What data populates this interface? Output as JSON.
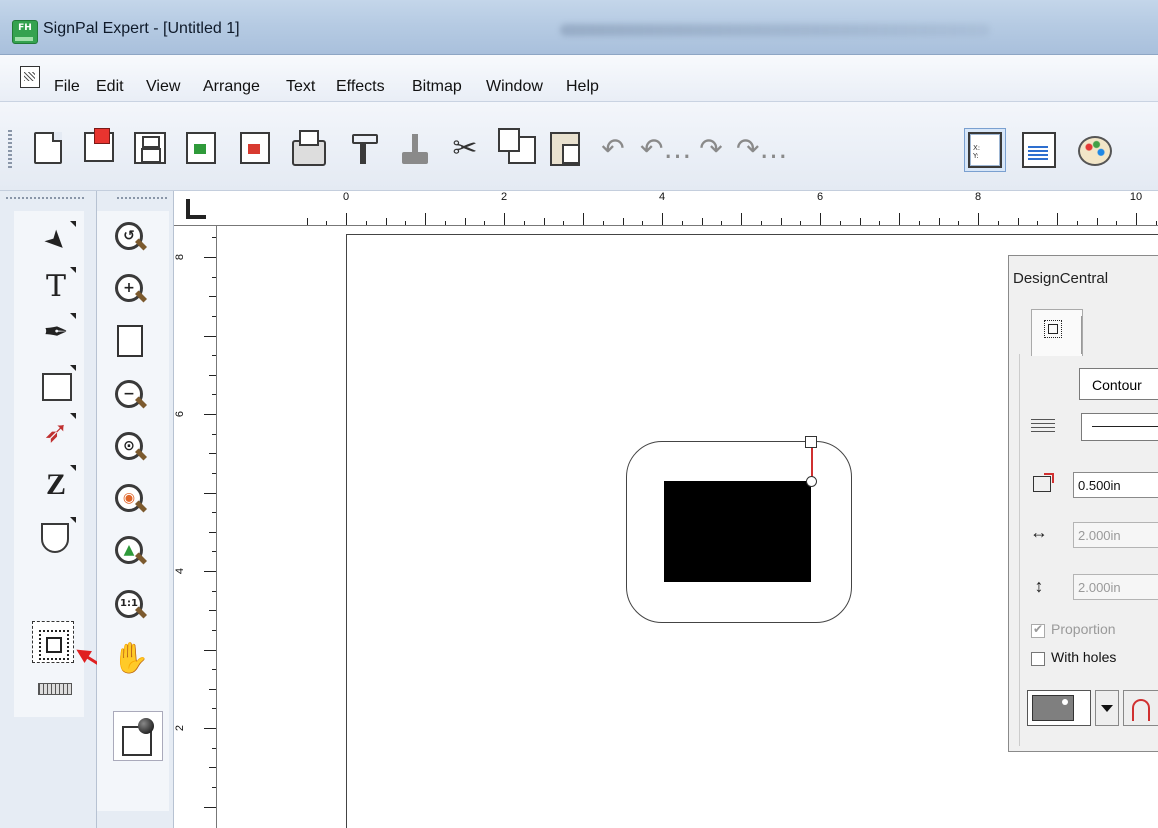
{
  "window": {
    "title": "SignPal Expert - [Untitled 1]",
    "app_icon_text": "FH"
  },
  "menu": {
    "items": [
      "File",
      "Edit",
      "View",
      "Arrange",
      "Text",
      "Effects",
      "Bitmap",
      "Window",
      "Help"
    ]
  },
  "toolbar": {
    "buttons": [
      "new-icon",
      "open-icon",
      "save-icon",
      "import-icon",
      "export-icon",
      "print-icon",
      "cut-icon",
      "plot-icon",
      "scissors-icon",
      "copy-icon",
      "paste-icon",
      "undo-icon",
      "undo-multiple-icon",
      "redo-icon",
      "redo-multiple-icon",
      "xyz-icon",
      "list-icon",
      "palette-icon"
    ],
    "glyphs": {
      "scissors": "✂",
      "undo": "↶",
      "undo_multi": "↶…",
      "redo": "↷",
      "redo_multi": "↷…"
    }
  },
  "tools": {
    "column1": [
      "select-icon",
      "text-icon",
      "pen-icon",
      "rectangle-icon",
      "node-edit-icon",
      "zigzag-icon",
      "shape-icon",
      "contour-tool-icon",
      "ruler-icon"
    ],
    "column1_glyphs": {
      "select": "➤",
      "text": "T",
      "pen": "✒",
      "node": "➶",
      "zigzag": "Z"
    },
    "column2": [
      "zoom-previous-icon",
      "zoom-in-icon",
      "zoom-page-icon",
      "zoom-out-icon",
      "zoom-all-icon",
      "zoom-selection-icon",
      "zoom-object-icon",
      "zoom-actual-icon",
      "pan-hand-icon",
      "fill-stroke-icon"
    ],
    "column2_glyphs": {
      "previous": "↺",
      "in": "+",
      "out": "−",
      "all": "⊙",
      "selection": "◉",
      "object": "▲",
      "actual": "1:1",
      "hand": "✋"
    },
    "selected_tool": "contour-tool-icon"
  },
  "rulers": {
    "horizontal_labels": [
      "0",
      "2",
      "4",
      "6",
      "8",
      "10"
    ],
    "vertical_labels": [
      "8",
      "6",
      "4",
      "2"
    ]
  },
  "design_central": {
    "title": "DesignCentral",
    "mode_value": "Contour",
    "offset_value": "0.500in",
    "width_value": "2.000in",
    "height_value": "2.000in",
    "width_icon": "↔",
    "height_icon": "↕",
    "proportional_label": "Proportion",
    "proportional_checked": true,
    "with_holes_label": "With holes",
    "with_holes_checked": false
  },
  "colors": {
    "accent_arrow": "#e02020",
    "selection_handle_line": "#d03030"
  }
}
